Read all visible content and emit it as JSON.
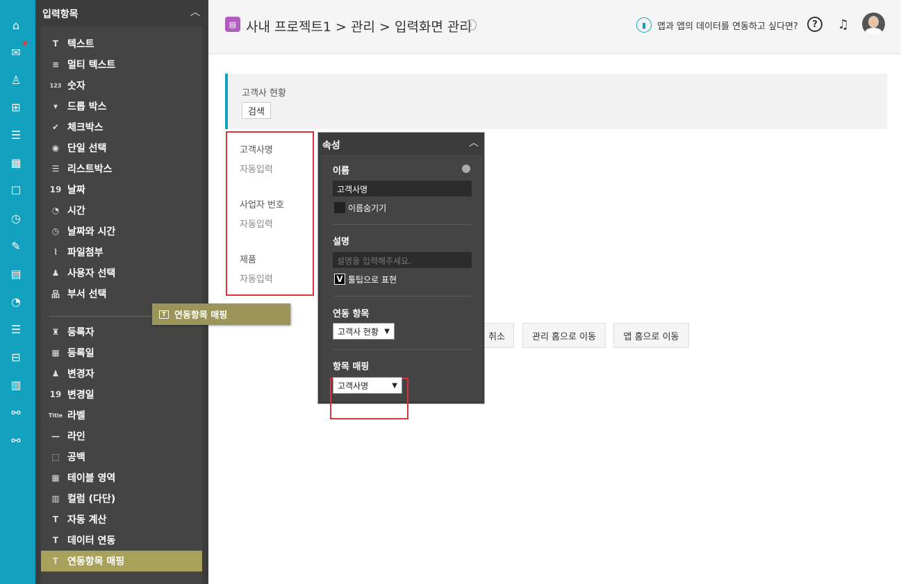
{
  "palette": {
    "title": "입력항목",
    "items": [
      {
        "label": "텍스트",
        "icon": "text-icon",
        "glyph": "T"
      },
      {
        "label": "멀티 텍스트",
        "icon": "multitext-icon",
        "glyph": "≡"
      },
      {
        "label": "숫자",
        "icon": "number-icon",
        "glyph": "123"
      },
      {
        "label": "드롭 박스",
        "icon": "dropbox-icon",
        "glyph": "▾"
      },
      {
        "label": "체크박스",
        "icon": "checkbox-icon",
        "glyph": "✔"
      },
      {
        "label": "단일 선택",
        "icon": "radio-icon",
        "glyph": "◉"
      },
      {
        "label": "리스트박스",
        "icon": "listbox-icon",
        "glyph": "☰"
      },
      {
        "label": "날짜",
        "icon": "calendar-icon",
        "glyph": "19"
      },
      {
        "label": "시간",
        "icon": "clock-icon",
        "glyph": "◔"
      },
      {
        "label": "날짜와 시간",
        "icon": "datetime-icon",
        "glyph": "◷"
      },
      {
        "label": "파일첨부",
        "icon": "paperclip-icon",
        "glyph": "⌇"
      },
      {
        "label": "사용자 선택",
        "icon": "user-select-icon",
        "glyph": "♟"
      },
      {
        "label": "부서 선택",
        "icon": "org-chart-icon",
        "glyph": "品"
      },
      {
        "label": "등록자",
        "icon": "registrant-icon",
        "glyph": "♜"
      },
      {
        "label": "등록일",
        "icon": "reg-date-icon",
        "glyph": "▦"
      },
      {
        "label": "변경자",
        "icon": "modifier-icon",
        "glyph": "♟"
      },
      {
        "label": "변경일",
        "icon": "mod-date-icon",
        "glyph": "19"
      },
      {
        "label": "라벨",
        "icon": "label-icon",
        "glyph": "Title"
      },
      {
        "label": "라인",
        "icon": "line-icon",
        "glyph": "—"
      },
      {
        "label": "공백",
        "icon": "blank-icon",
        "glyph": "⬚"
      },
      {
        "label": "테이블 영역",
        "icon": "table-icon",
        "glyph": "▦"
      },
      {
        "label": "컬럼 (다단)",
        "icon": "columns-icon",
        "glyph": "▥"
      },
      {
        "label": "자동 계산",
        "icon": "auto-calc-icon",
        "glyph": "T"
      },
      {
        "label": "데이터 연동",
        "icon": "data-link-icon",
        "glyph": "T"
      },
      {
        "label": "연동항목 매핑",
        "icon": "mapping-icon",
        "glyph": "T"
      }
    ]
  },
  "header": {
    "breadcrumb": "사내 프로젝트1 > 관리 > 입력화면 관리",
    "help_text": "앱과 앱의 데이터를 연동하고 싶다면?"
  },
  "search": {
    "label": "고객사 현황",
    "button": "검색"
  },
  "fields": [
    {
      "label": "고객사명",
      "value": "자동입력"
    },
    {
      "label": "사업자 번호",
      "value": "자동입력"
    },
    {
      "label": "제품",
      "value": "자동입력"
    }
  ],
  "buttons": {
    "cancel": "취소",
    "admin_home": "관리 홈으로 이동",
    "app_home": "앱 홈으로 이동"
  },
  "props": {
    "title": "속성",
    "name_label": "이름",
    "name_value": "고객사명",
    "hide_name": "이름숨기기",
    "desc_label": "설명",
    "desc_placeholder": "설명을 입력해주세요.",
    "tooltip_label": "툴팁으로 표현",
    "tooltip_check": "V",
    "link_label": "연동 항목",
    "link_value": "고객사 현황",
    "map_label": "항목 매핑",
    "map_value": "고객사명"
  },
  "drag_ghost": {
    "label": "연동항목 매핑"
  },
  "colors": {
    "rail": "#12a1bf",
    "active": "#a8a15c",
    "highlight": "#e0303a"
  }
}
